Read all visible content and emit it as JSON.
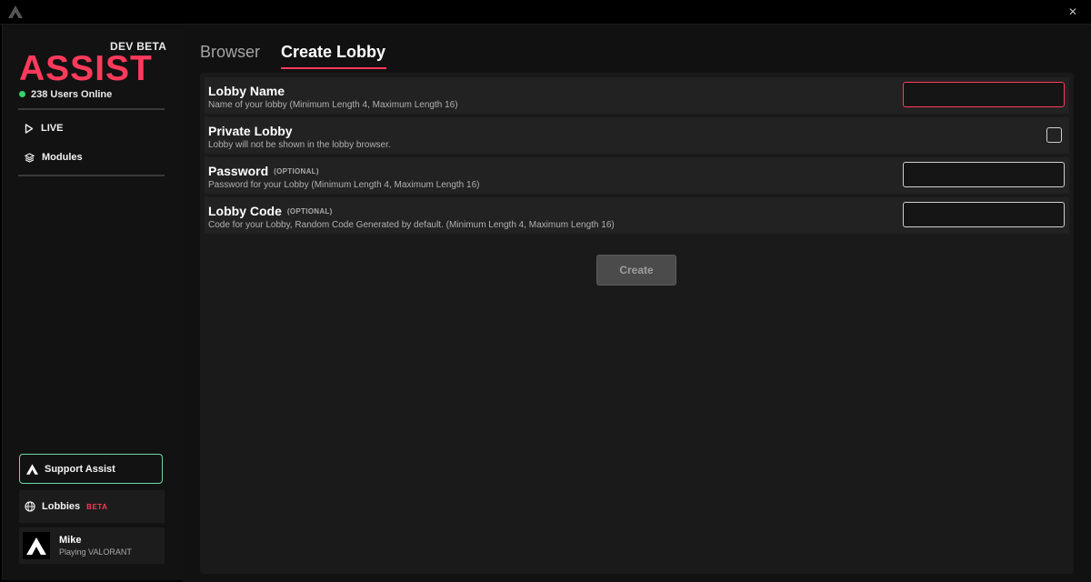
{
  "window": {
    "close_glyph": "✕"
  },
  "sidebar": {
    "brand_tag": "DEV BETA",
    "brand_name": "ASSIST",
    "online_text": "238 Users Online",
    "nav": [
      {
        "label": "LIVE",
        "icon": "play-icon"
      },
      {
        "label": "Modules",
        "icon": "layers-icon"
      }
    ],
    "support_label": "Support Assist",
    "lobbies_label": "Lobbies",
    "lobbies_badge": "BETA",
    "user": {
      "name": "Mike",
      "status": "Playing VALORANT"
    }
  },
  "tabs": [
    {
      "label": "Browser",
      "active": false
    },
    {
      "label": "Create Lobby",
      "active": true
    }
  ],
  "form": {
    "fields": [
      {
        "label": "Lobby Name",
        "optional": "",
        "description": "Name of your lobby (Minimum Length 4, Maximum Length 16)",
        "value": ""
      },
      {
        "label": "Private Lobby",
        "optional": "",
        "description": "Lobby will not be shown in the lobby browser.",
        "checked": false
      },
      {
        "label": "Password",
        "optional": "(OPTIONAL)",
        "description": "Password for your Lobby (Minimum Length 4, Maximum Length 16)",
        "value": ""
      },
      {
        "label": "Lobby Code",
        "optional": "(OPTIONAL)",
        "description": "Code for your Lobby, Random Code Generated by default. (Minimum Length 4, Maximum Length 16)",
        "value": ""
      }
    ],
    "submit_label": "Create"
  },
  "colors": {
    "accent": "#ff3a5b",
    "online": "#34d36b",
    "support_border": "#6dd8a6"
  }
}
